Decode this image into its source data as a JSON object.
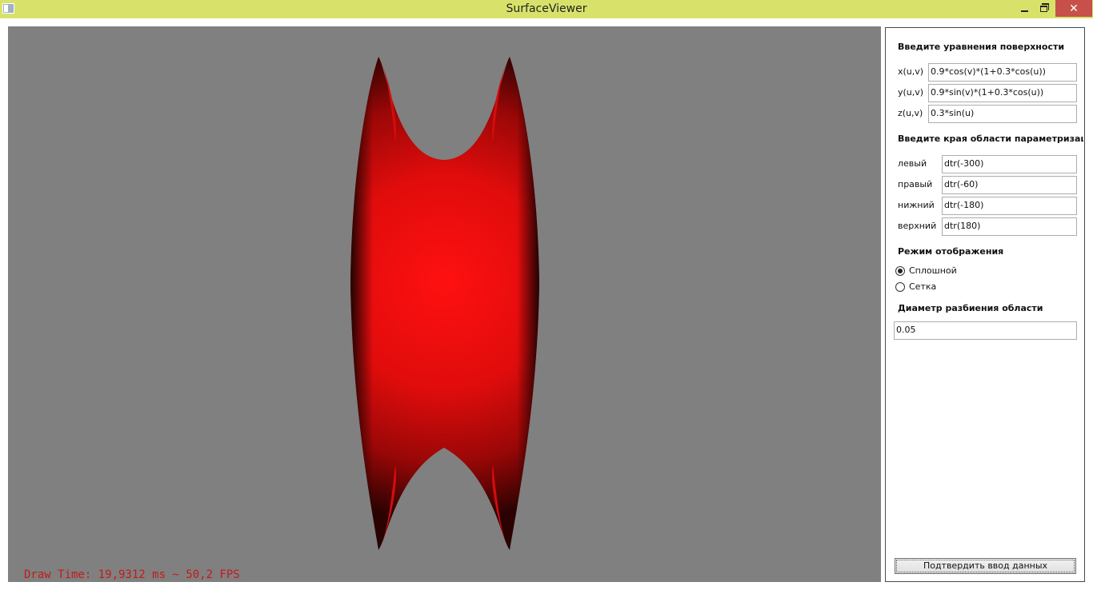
{
  "window": {
    "title": "SurfaceViewer",
    "close_glyph": "✕"
  },
  "viewport": {
    "status": "Draw Time: 19,9312 ms ~ 50,2 FPS",
    "background_color": "#808080",
    "surface_color": "#ff1010",
    "status_color": "#c41a1a"
  },
  "panel": {
    "equations_heading": "Введите уравнения поверхности",
    "equations": [
      {
        "label": "x(u,v)",
        "value": "0.9*cos(v)*(1+0.3*cos(u))"
      },
      {
        "label": "y(u,v)",
        "value": "0.9*sin(v)*(1+0.3*cos(u))"
      },
      {
        "label": "z(u,v)",
        "value": "0.3*sin(u)"
      }
    ],
    "bounds_heading": "Введите края области параметризации",
    "bounds": [
      {
        "label": "левый",
        "value": "dtr(-300)"
      },
      {
        "label": "правый",
        "value": "dtr(-60)"
      },
      {
        "label": "нижний",
        "value": "dtr(-180)"
      },
      {
        "label": "верхний",
        "value": "dtr(180)"
      }
    ],
    "mode_heading": "Режим отображения",
    "modes": [
      {
        "label": "Сплошной",
        "selected": true
      },
      {
        "label": "Сетка",
        "selected": false
      }
    ],
    "diameter_heading": "Диаметр разбиения области",
    "diameter_value": "0.05",
    "submit_label": "Подтвердить ввод данных"
  }
}
